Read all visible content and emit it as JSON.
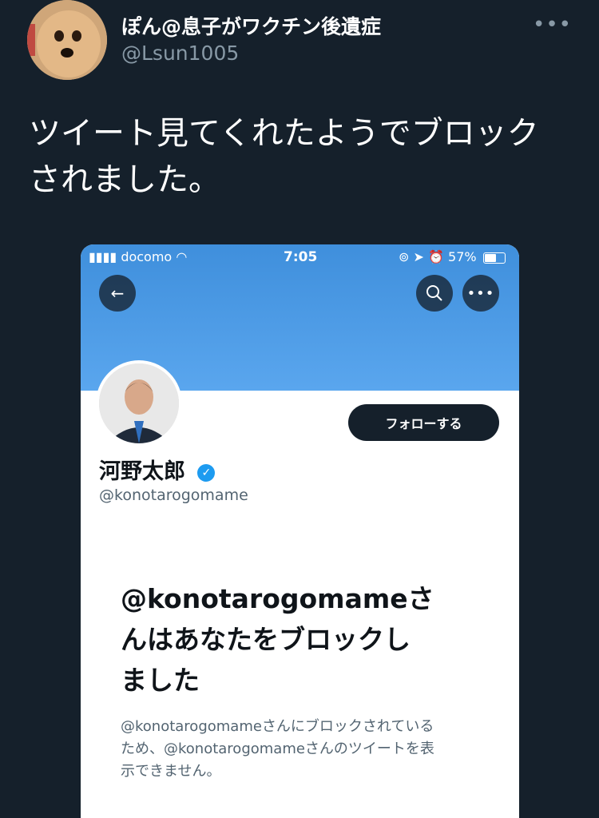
{
  "tweet": {
    "author_name": "ぽん@息子がワクチン後遺症",
    "author_handle": "@Lsun1005",
    "more_icon": "more-horizontal-icon",
    "text_line1": "ツイート見てくれたようでブロック",
    "text_line2": "されました。"
  },
  "screenshot": {
    "status_bar": {
      "carrier": "docomo",
      "time": "7:05",
      "battery": "57%"
    },
    "profile": {
      "name": "河野太郎",
      "handle": "@konotarogomame",
      "follow_label": "フォローする",
      "verified_icon": "verified-badge-icon"
    },
    "blocked": {
      "title_line1": "@konotarogomameさ",
      "title_line2": "んはあなたをブロックし",
      "title_line3": "ました",
      "desc_line1": "@konotarogomameさんにブロックされている",
      "desc_line2": "ため、@konotarogomameさんのツイートを表",
      "desc_line3": "示できません。"
    },
    "colors": {
      "banner": "#4a9be8",
      "verified": "#1d9bf0",
      "follow_button": "#15202b"
    }
  }
}
